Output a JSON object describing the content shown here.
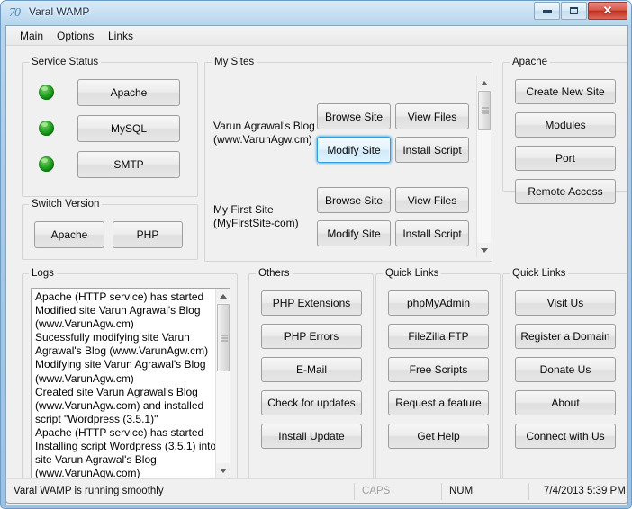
{
  "window": {
    "title": "Varal WAMP",
    "logo_text": "70",
    "controls": {
      "minimize": "Minimize",
      "maximize": "Maximize",
      "close": "✕"
    }
  },
  "menubar": {
    "items": [
      {
        "label": "Main"
      },
      {
        "label": "Options"
      },
      {
        "label": "Links"
      }
    ]
  },
  "service_status": {
    "legend": "Service Status",
    "services": [
      {
        "name": "Apache",
        "status_color": "#1aa01a"
      },
      {
        "name": "MySQL",
        "status_color": "#1aa01a"
      },
      {
        "name": "SMTP",
        "status_color": "#1aa01a"
      }
    ]
  },
  "switch_version": {
    "legend": "Switch Version",
    "buttons": [
      {
        "label": "Apache"
      },
      {
        "label": "PHP"
      }
    ]
  },
  "my_sites": {
    "legend": "My Sites",
    "sites": [
      {
        "name": "Varun Agrawal's Blog",
        "url": "(www.VarunAgw.cm)",
        "actions": [
          {
            "label": "Browse Site",
            "focused": false
          },
          {
            "label": "View Files",
            "focused": false
          },
          {
            "label": "Modify Site",
            "focused": true
          },
          {
            "label": "Install Script",
            "focused": false
          }
        ]
      },
      {
        "name": "My First Site",
        "url": "(MyFirstSite-com)",
        "actions": [
          {
            "label": "Browse Site",
            "focused": false
          },
          {
            "label": "View Files",
            "focused": false
          },
          {
            "label": "Modify Site",
            "focused": false
          },
          {
            "label": "Install Script",
            "focused": false
          }
        ]
      }
    ]
  },
  "apache": {
    "legend": "Apache",
    "buttons": [
      {
        "label": "Create New Site"
      },
      {
        "label": "Modules"
      },
      {
        "label": "Port"
      },
      {
        "label": "Remote Access"
      }
    ]
  },
  "logs": {
    "legend": "Logs",
    "text": "Apache (HTTP service) has started\nModified site Varun Agrawal's Blog (www.VarunAgw.cm)\nSucessfully modifying site Varun Agrawal's Blog (www.VarunAgw.cm)\nModifying site Varun Agrawal's Blog (www.VarunAgw.cm)\nCreated site Varun Agrawal's Blog (www.VarunAgw.com) and installed script \"Wordpress (3.5.1)\"\nApache (HTTP service) has started\nInstalling script Wordpress (3.5.1) into site Varun Agrawal's Blog (www.VarunAgw.com)"
  },
  "others": {
    "legend": "Others",
    "buttons": [
      {
        "label": "PHP Extensions"
      },
      {
        "label": "PHP Errors"
      },
      {
        "label": "E-Mail"
      },
      {
        "label": "Check for updates"
      },
      {
        "label": "Install Update"
      }
    ]
  },
  "quick_links_1": {
    "legend": "Quick Links",
    "buttons": [
      {
        "label": "phpMyAdmin"
      },
      {
        "label": "FileZilla FTP"
      },
      {
        "label": "Free Scripts"
      },
      {
        "label": "Request a feature"
      },
      {
        "label": "Get Help"
      }
    ]
  },
  "quick_links_2": {
    "legend": "Quick Links",
    "buttons": [
      {
        "label": "Visit Us"
      },
      {
        "label": "Register a Domain"
      },
      {
        "label": "Donate Us"
      },
      {
        "label": "About"
      },
      {
        "label": "Connect with Us"
      }
    ]
  },
  "statusbar": {
    "message": "Varal WAMP is running smoothly",
    "caps": "CAPS",
    "num": "NUM",
    "datetime": "7/4/2013  5:39 PM"
  }
}
